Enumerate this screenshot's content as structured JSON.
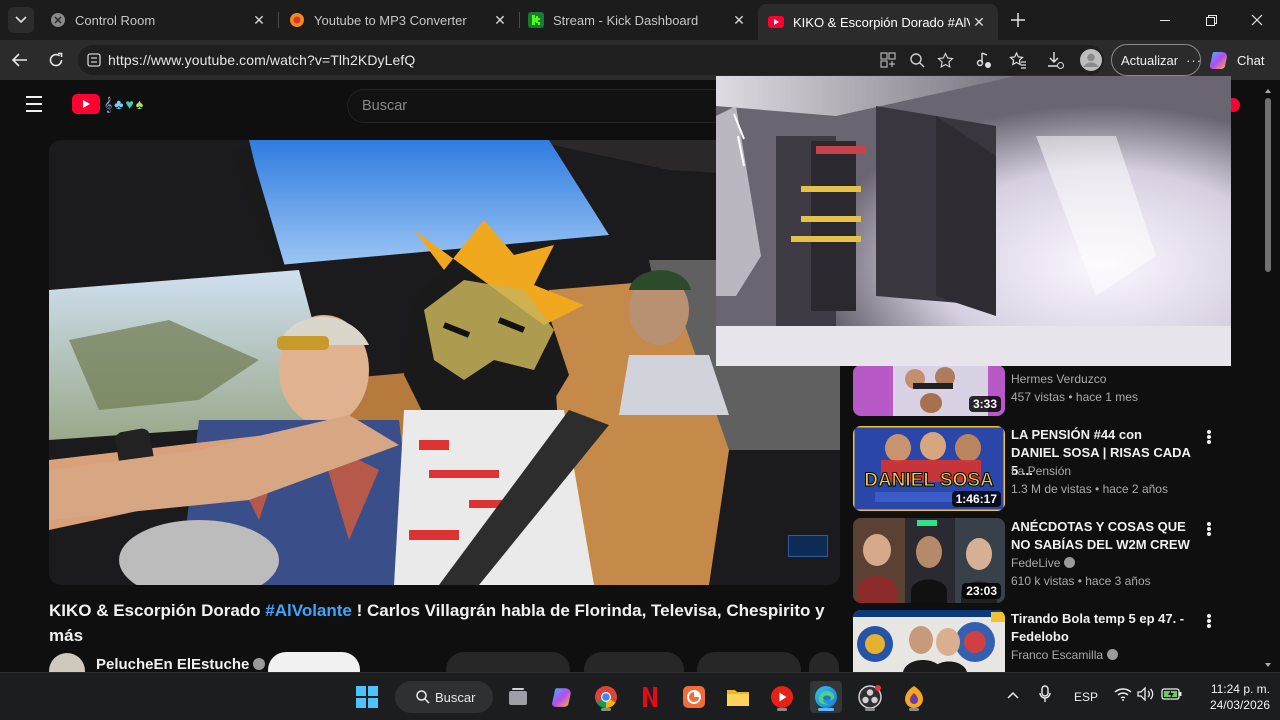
{
  "browser": {
    "tabs": [
      {
        "title": "Control Room",
        "icon": "control-room-icon",
        "active": false
      },
      {
        "title": "Youtube to MP3 Converter",
        "icon": "converter-icon",
        "active": false
      },
      {
        "title": "Stream - Kick Dashboard",
        "icon": "kick-icon",
        "active": false
      },
      {
        "title": "KIKO & Escorpión Dorado #AlVola",
        "icon": "youtube-icon",
        "active": true
      }
    ],
    "url": "https://www.youtube.com/watch?v=Tlh2KDyLefQ",
    "update_label": "Actualizar",
    "chat_label": "Chat"
  },
  "youtube": {
    "search_placeholder": "Buscar",
    "video": {
      "title_part1": "KIKO & Escorpión Dorado ",
      "hashtag": "#AlVolante",
      "title_part2": " ! Carlos Villagrán habla de Florinda, Televisa, Chespirito y más",
      "channel": "PelucheEn ElEstuche"
    },
    "recommendations": [
      {
        "title": "",
        "channel": "Hermes Verduzco",
        "verified": false,
        "views": "457 vistas",
        "age": "hace 1 mes",
        "duration": "3:33"
      },
      {
        "title": "LA PENSIÓN #44 con DANIEL SOSA | RISAS CADA 5 ...",
        "channel": "La Pensión",
        "verified": false,
        "views": "1.3 M de vistas",
        "age": "hace 2 años",
        "duration": "1:46:17"
      },
      {
        "title": "ANÉCDOTAS Y COSAS QUE NO SABÍAS DEL W2M CREW",
        "channel": "FedeLive",
        "verified": true,
        "views": "610 k vistas",
        "age": "hace 3 años",
        "duration": "23:03"
      },
      {
        "title": "Tirando Bola temp 5 ep 47. - Fedelobo",
        "channel": "Franco Escamilla",
        "verified": true,
        "views": "",
        "age": "",
        "duration": ""
      }
    ],
    "thumb_text": {
      "daniel_sosa": "DANIEL SOSA"
    }
  },
  "taskbar": {
    "search_label": "Buscar",
    "language": "ESP",
    "time": "11:24 p. m.",
    "date": "24/03/2026"
  }
}
